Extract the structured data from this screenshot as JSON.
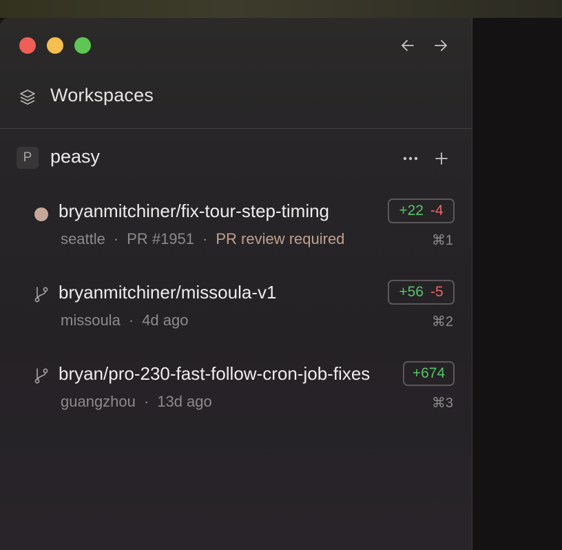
{
  "colors": {
    "close": "#ee5f57",
    "minimize": "#f6bd4f",
    "maximize": "#5fc554",
    "additions": "#56c46a",
    "deletions": "#e8676a",
    "warning": "#c2a08f",
    "status_dot": "#c5a899"
  },
  "nav": {
    "back_icon": "arrow-left-icon",
    "forward_icon": "arrow-right-icon"
  },
  "header": {
    "icon": "layers-icon",
    "title": "Workspaces"
  },
  "project": {
    "badge": "P",
    "name": "peasy",
    "more_icon": "ellipsis-icon",
    "add_icon": "plus-icon"
  },
  "workspaces": [
    {
      "icon": "status-dot",
      "title": "bryanmitchiner/fix-tour-step-timing",
      "additions": "+22",
      "deletions": "-4",
      "location": "seattle",
      "pr": "PR #1951",
      "status": "PR review required",
      "shortcut": "⌘1"
    },
    {
      "icon": "git-branch-icon",
      "title": "bryanmitchiner/missoula-v1",
      "additions": "+56",
      "deletions": "-5",
      "location": "missoula",
      "age": "4d ago",
      "shortcut": "⌘2"
    },
    {
      "icon": "git-branch-icon",
      "title": "bryan/pro-230-fast-follow-cron-job-fixes",
      "additions": "+674",
      "location": "guangzhou",
      "age": "13d ago",
      "shortcut": "⌘3"
    }
  ]
}
